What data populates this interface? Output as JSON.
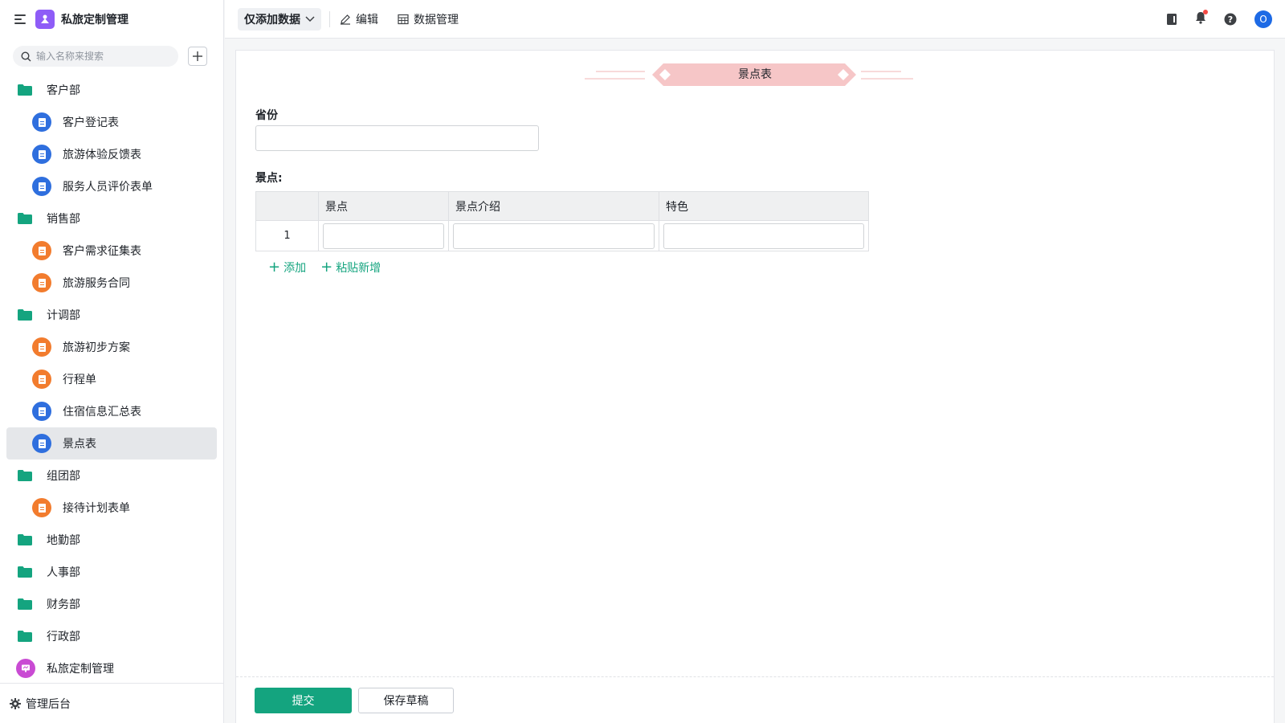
{
  "app": {
    "title": "私旅定制管理"
  },
  "search": {
    "placeholder": "输入名称来搜索"
  },
  "tree": {
    "items": [
      {
        "type": "folder",
        "label": "客户部"
      },
      {
        "type": "form",
        "color": "blue",
        "label": "客户登记表"
      },
      {
        "type": "form",
        "color": "blue",
        "label": "旅游体验反馈表"
      },
      {
        "type": "form",
        "color": "blue",
        "label": "服务人员评价表单"
      },
      {
        "type": "folder",
        "label": "销售部"
      },
      {
        "type": "form",
        "color": "orange",
        "label": "客户需求征集表"
      },
      {
        "type": "form",
        "color": "orange",
        "label": "旅游服务合同"
      },
      {
        "type": "folder",
        "label": "计调部"
      },
      {
        "type": "form",
        "color": "orange",
        "label": "旅游初步方案"
      },
      {
        "type": "form",
        "color": "orange",
        "label": "行程单"
      },
      {
        "type": "form",
        "color": "blue",
        "label": "住宿信息汇总表"
      },
      {
        "type": "form",
        "color": "blue",
        "label": "景点表",
        "selected": true
      },
      {
        "type": "folder",
        "label": "组团部"
      },
      {
        "type": "form",
        "color": "orange",
        "label": "接待计划表单"
      },
      {
        "type": "folder",
        "label": "地勤部"
      },
      {
        "type": "folder",
        "label": "人事部"
      },
      {
        "type": "folder",
        "label": "财务部"
      },
      {
        "type": "folder",
        "label": "行政部"
      },
      {
        "type": "app",
        "label": "私旅定制管理"
      }
    ]
  },
  "sidebar_footer": {
    "label": "管理后台",
    "icon": "gear-icon"
  },
  "toolbar": {
    "mode_label": "仅添加数据",
    "edit_label": "编辑",
    "data_manage_label": "数据管理",
    "avatar_letter": "O"
  },
  "form": {
    "title": "景点表",
    "province_label": "省份",
    "province_value": "",
    "scenic_label": "景点:",
    "table": {
      "columns": [
        "景点",
        "景点介绍",
        "特色"
      ],
      "rows": [
        {
          "index": "1",
          "values": [
            "",
            "",
            ""
          ]
        }
      ]
    },
    "add_label": "添加",
    "paste_add_label": "粘贴新增",
    "submit_label": "提交",
    "draft_label": "保存草稿"
  },
  "colors": {
    "accent": "#14a47f",
    "folder": "#14a47f",
    "form_blue": "#2f6fde",
    "form_orange": "#f27c2e",
    "title_ribbon": "#f6c6c7"
  }
}
